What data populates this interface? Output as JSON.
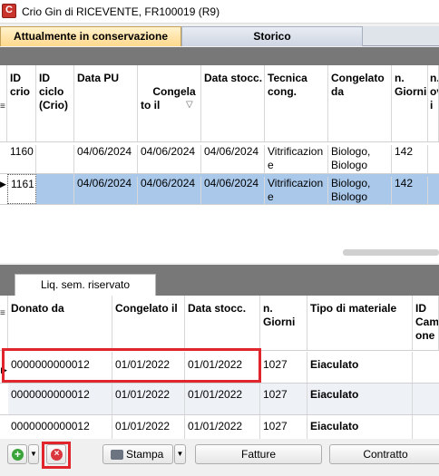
{
  "window": {
    "title": "Crio Gin di RICEVENTE, FR100019 (R9)"
  },
  "tabs": {
    "current": "Attualmente in conservazione",
    "history": "Storico"
  },
  "upper_grid": {
    "headers": {
      "id_crio": "ID\ncrio",
      "id_ciclo": "ID\nciclo\n(Crio)",
      "data_pu": "Data PU",
      "congelato_il": "Congela\nto il",
      "data_stocc": "Data stocc.",
      "tecnica": "Tecnica\ncong.",
      "congelato_da": "Congelato\nda",
      "n_giorni": "n.\nGiorni",
      "extra": "n.\nov\ni"
    },
    "rows": [
      {
        "id": "1160",
        "data_pu": "04/06/2024",
        "congelato_il": "04/06/2024",
        "data_stocc": "04/06/2024",
        "tecnica": "Vitrificazion\ne",
        "congelato_da": "Biologo,\nBiologo",
        "giorni": "142"
      },
      {
        "id": "1161",
        "data_pu": "04/06/2024",
        "congelato_il": "04/06/2024",
        "data_stocc": "04/06/2024",
        "tecnica": "Vitrificazion\ne",
        "congelato_da": "Biologo,\nBiologo",
        "giorni": "142"
      }
    ]
  },
  "lower_tab": {
    "label": "Liq. sem. riservato"
  },
  "lower_grid": {
    "headers": {
      "donato_da": "Donato da",
      "congelato_il": "Congelato il",
      "data_stocc": "Data stocc.",
      "n_giorni": "n. Giorni",
      "tipo": "Tipo di materiale",
      "id_camp": "ID\nCam\none"
    },
    "rows": [
      {
        "donato": "0000000000012",
        "congelato": "01/01/2022",
        "stocc": "01/01/2022",
        "giorni": "1027",
        "tipo": "Eiaculato"
      },
      {
        "donato": "0000000000012",
        "congelato": "01/01/2022",
        "stocc": "01/01/2022",
        "giorni": "1027",
        "tipo": "Eiaculato"
      },
      {
        "donato": "0000000000012",
        "congelato": "01/01/2022",
        "stocc": "01/01/2022",
        "giorni": "1027",
        "tipo": "Eiaculato"
      }
    ]
  },
  "toolbar": {
    "print_label": "Stampa",
    "invoices_label": "Fatture",
    "contract_label": "Contratto"
  },
  "icons": {
    "app": "app-logo-icon",
    "add": "add-icon",
    "delete": "delete-icon",
    "print": "printer-icon",
    "dropdown": "chevron-down-icon",
    "sort": "sort-icon",
    "row_indicator": "row-indicator-icon"
  },
  "colors": {
    "active_tab": "#ffd88c",
    "selected_row": "#a9c8ea",
    "highlight": "#e0262c",
    "add_green": "#3aa33a",
    "delete_red": "#d9363e"
  }
}
